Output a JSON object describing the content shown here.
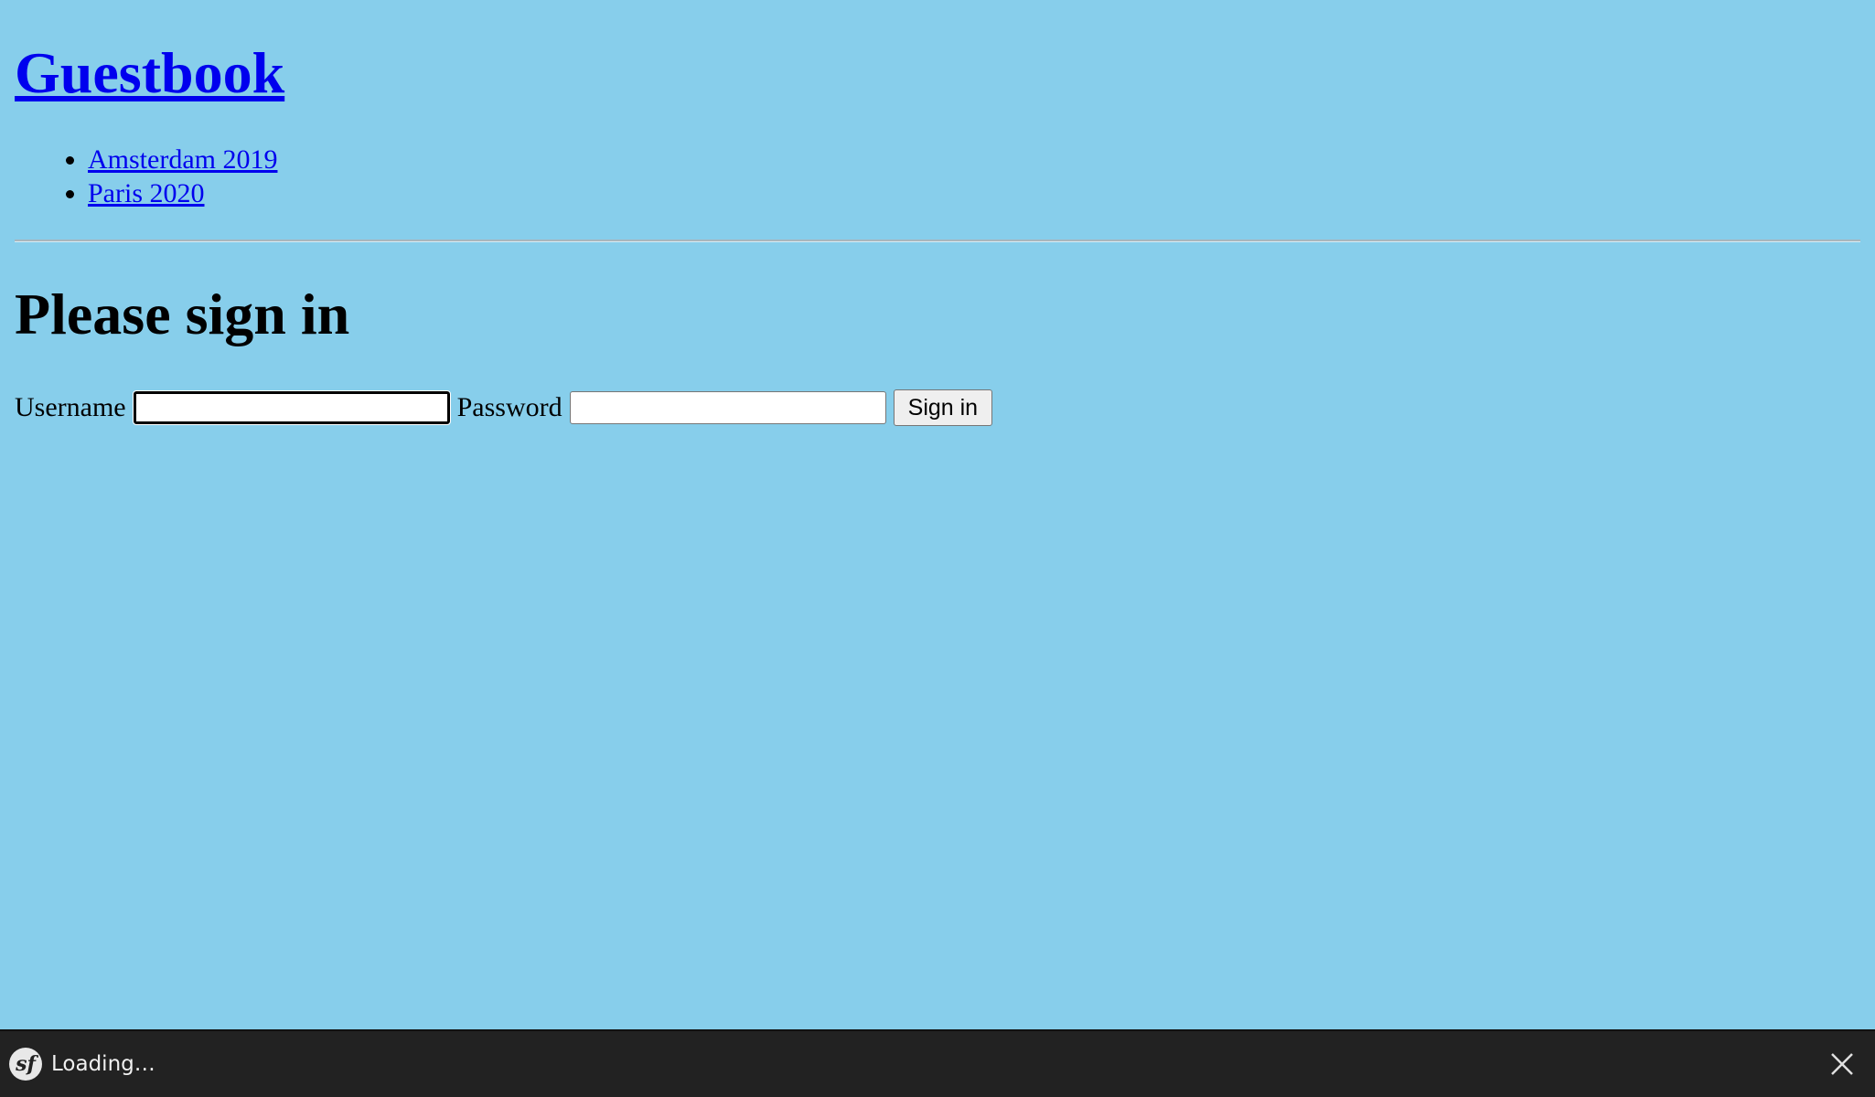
{
  "site": {
    "title": "Guestbook"
  },
  "conferences": [
    {
      "label": "Amsterdam 2019"
    },
    {
      "label": "Paris 2020"
    }
  ],
  "signin": {
    "heading": "Please sign in",
    "username_label": "Username",
    "username_value": "",
    "password_label": "Password",
    "password_value": "",
    "submit_label": "Sign in"
  },
  "toolbar": {
    "logo_icon": "symfony-logo-icon",
    "logo_text": "sf",
    "status": "Loading…",
    "close_icon": "close-icon"
  },
  "colors": {
    "page_background": "#87ceeb",
    "link": "#0000ee",
    "toolbar_background": "#222222"
  }
}
